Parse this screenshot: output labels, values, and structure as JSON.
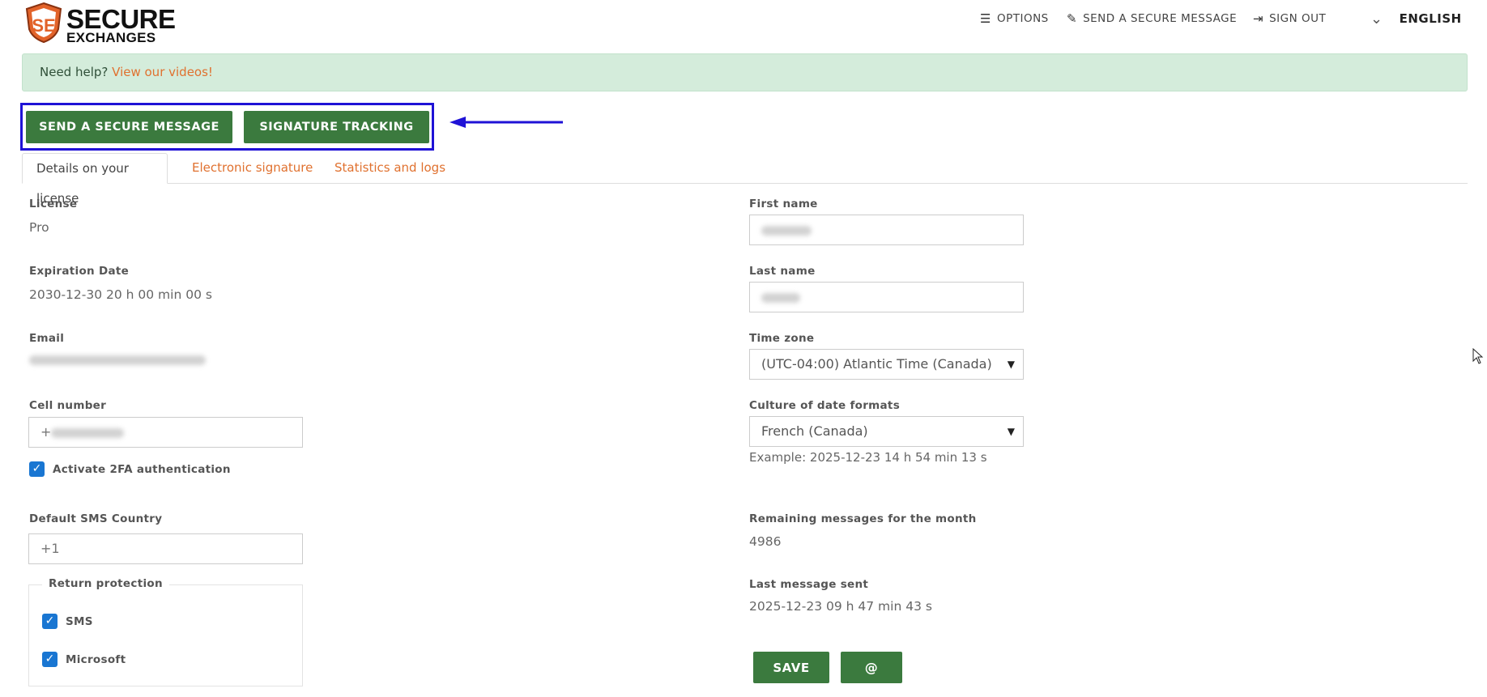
{
  "brand": {
    "line1": "SECURE",
    "line2": "EXCHANGES"
  },
  "topnav": {
    "options": "OPTIONS",
    "send": "SEND A SECURE MESSAGE",
    "signout": "SIGN OUT",
    "language": "ENGLISH"
  },
  "help": {
    "text": "Need help?",
    "link": "View our videos!"
  },
  "actions": {
    "send": "SEND A SECURE MESSAGE",
    "signature": "SIGNATURE TRACKING"
  },
  "tabs": [
    "Details on your license",
    "Electronic signature",
    "Statistics and logs"
  ],
  "left": {
    "license_label": "License",
    "license_value": "Pro",
    "expiration_label": "Expiration Date",
    "expiration_value": "2030-12-30 20 h 00 min 00 s",
    "email_label": "Email",
    "cell_label": "Cell number",
    "cell_prefix": "+",
    "twofa_label": "Activate 2FA authentication",
    "sms_country_label": "Default SMS Country",
    "sms_country_value": "+1",
    "return_protection_label": "Return protection",
    "sms_label": "SMS",
    "microsoft_label": "Microsoft"
  },
  "right": {
    "first_name_label": "First name",
    "last_name_label": "Last name",
    "timezone_label": "Time zone",
    "timezone_value": "(UTC-04:00) Atlantic Time (Canada)",
    "culture_label": "Culture of date formats",
    "culture_value": "French (Canada)",
    "culture_example": "Example: 2025-12-23 14 h 54 min 13 s",
    "remaining_label": "Remaining messages for the month",
    "remaining_value": "4986",
    "last_sent_label": "Last message sent",
    "last_sent_value": "2025-12-23 09 h 47 min 43 s",
    "save": "SAVE",
    "at": "@"
  },
  "colors": {
    "accent_green": "#3b7a3e",
    "link_orange": "#e0712f",
    "highlight_blue": "#1f12d6",
    "checkbox_blue": "#1976d2"
  }
}
